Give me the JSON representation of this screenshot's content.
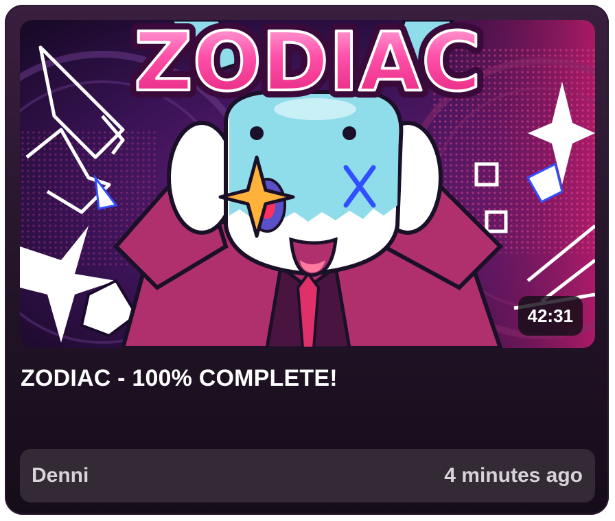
{
  "video": {
    "thumbnail_logo": "ZODIAC",
    "duration": "42:31",
    "title": "ZODIAC - 100% COMPLETE!",
    "author": "Denni",
    "posted": "4 minutes ago"
  },
  "colors": {
    "card_bg": "#2b1a30",
    "meta_bg": "#332a35",
    "logo_pink": "#ff3f9a",
    "accent_blue": "#8fdcea"
  },
  "icons": {
    "thumbnail": "character-art-thumbnail"
  }
}
